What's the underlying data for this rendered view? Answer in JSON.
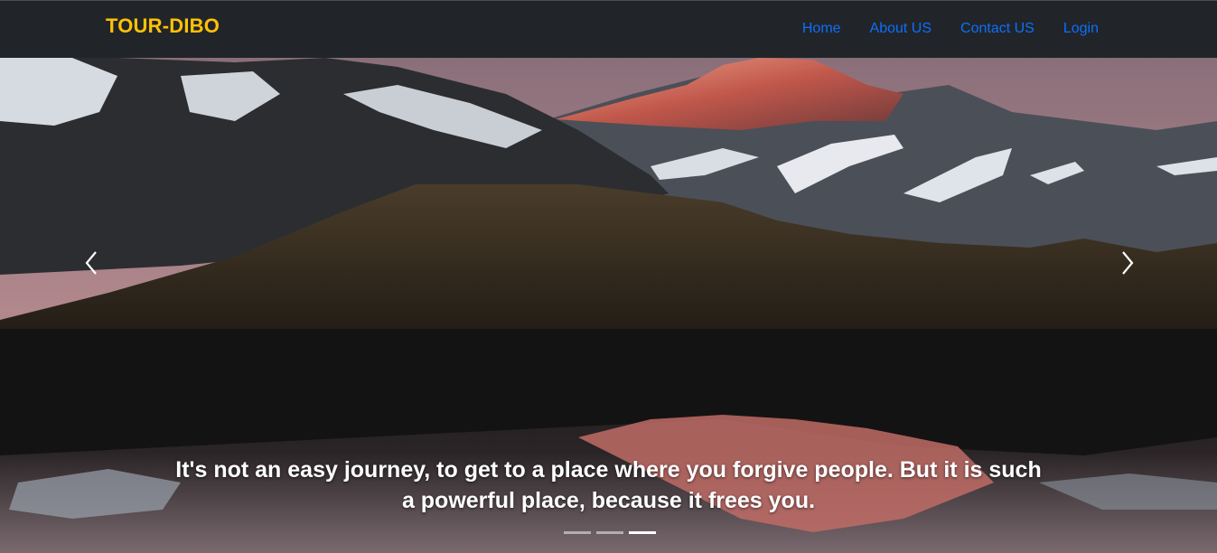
{
  "navbar": {
    "brand": "TOUR-DIBO",
    "links": [
      {
        "label": "Home"
      },
      {
        "label": "About US"
      },
      {
        "label": "Contact US"
      },
      {
        "label": "Login"
      }
    ]
  },
  "carousel": {
    "caption": "It's not an easy journey, to get to a place where you forgive people. But it is such a powerful place, because it frees you.",
    "prev_icon": "chevron-left-icon",
    "next_icon": "chevron-right-icon",
    "slide_count": 3,
    "active_slide": 3
  },
  "colors": {
    "navbar_bg": "#212529",
    "brand": "#ffc107",
    "link": "#0d6efd"
  }
}
